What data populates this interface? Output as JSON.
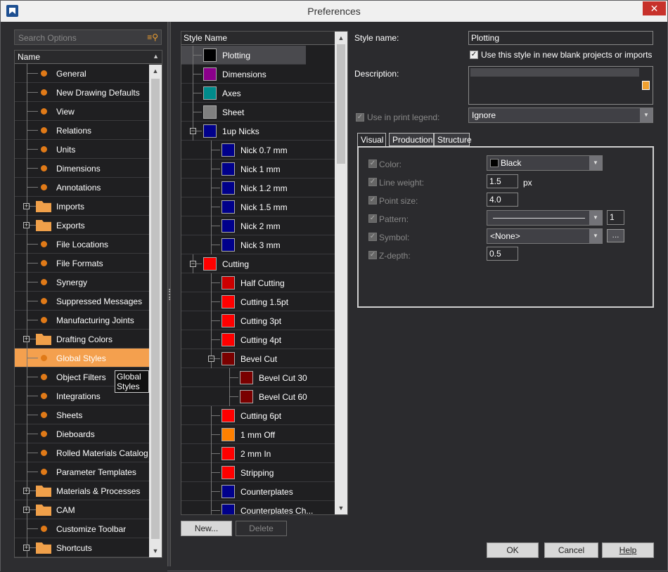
{
  "window": {
    "title": "Preferences",
    "close": "✕"
  },
  "left": {
    "search_placeholder": "Search Options",
    "tree_header": "Name",
    "items": [
      {
        "label": "General",
        "kind": "dot"
      },
      {
        "label": "New Drawing Defaults",
        "kind": "dot"
      },
      {
        "label": "View",
        "kind": "dot"
      },
      {
        "label": "Relations",
        "kind": "dot"
      },
      {
        "label": "Units",
        "kind": "dot"
      },
      {
        "label": "Dimensions",
        "kind": "dot"
      },
      {
        "label": "Annotations",
        "kind": "dot"
      },
      {
        "label": "Imports",
        "kind": "folder"
      },
      {
        "label": "Exports",
        "kind": "folder"
      },
      {
        "label": "File Locations",
        "kind": "dot"
      },
      {
        "label": "File Formats",
        "kind": "dot"
      },
      {
        "label": "Synergy",
        "kind": "dot"
      },
      {
        "label": "Suppressed Messages",
        "kind": "dot"
      },
      {
        "label": "Manufacturing Joints",
        "kind": "dot"
      },
      {
        "label": "Drafting Colors",
        "kind": "folder"
      },
      {
        "label": "Global Styles",
        "kind": "dot",
        "selected": true
      },
      {
        "label": "Object Filters",
        "kind": "dot"
      },
      {
        "label": "Integrations",
        "kind": "dot"
      },
      {
        "label": "Sheets",
        "kind": "dot"
      },
      {
        "label": "Dieboards",
        "kind": "dot"
      },
      {
        "label": "Rolled Materials Catalog",
        "kind": "dot"
      },
      {
        "label": "Parameter Templates",
        "kind": "dot"
      },
      {
        "label": "Materials & Processes",
        "kind": "folder"
      },
      {
        "label": "CAM",
        "kind": "folder"
      },
      {
        "label": "Customize Toolbar",
        "kind": "dot"
      },
      {
        "label": "Shortcuts",
        "kind": "folder"
      }
    ],
    "tooltip": "Global Styles"
  },
  "styles": {
    "header": "Style Name",
    "items": [
      {
        "label": "Plotting",
        "color": "#000000",
        "level": 0,
        "selected": true
      },
      {
        "label": "Dimensions",
        "color": "#8b008b",
        "level": 0
      },
      {
        "label": "Axes",
        "color": "#008b8b",
        "level": 0
      },
      {
        "label": "Sheet",
        "color": "#808080",
        "level": 0
      },
      {
        "label": "1up Nicks",
        "color": "#00008b",
        "level": 0,
        "expander": true
      },
      {
        "label": "Nick 0.7 mm",
        "color": "#00008b",
        "level": 1
      },
      {
        "label": "Nick 1 mm",
        "color": "#00008b",
        "level": 1
      },
      {
        "label": "Nick 1.2 mm",
        "color": "#00008b",
        "level": 1
      },
      {
        "label": "Nick 1.5 mm",
        "color": "#00008b",
        "level": 1
      },
      {
        "label": "Nick 2 mm",
        "color": "#00008b",
        "level": 1
      },
      {
        "label": "Nick 3 mm",
        "color": "#00008b",
        "level": 1
      },
      {
        "label": "Cutting",
        "color": "#ff0000",
        "level": 0,
        "expander": true
      },
      {
        "label": "Half Cutting",
        "color": "#cc0000",
        "level": 1
      },
      {
        "label": "Cutting 1.5pt",
        "color": "#ff0000",
        "level": 1
      },
      {
        "label": "Cutting 3pt",
        "color": "#ff0000",
        "level": 1
      },
      {
        "label": "Cutting 4pt",
        "color": "#ff0000",
        "level": 1
      },
      {
        "label": "Bevel Cut",
        "color": "#7a0000",
        "level": 1,
        "expander": true
      },
      {
        "label": "Bevel Cut 30",
        "color": "#7a0000",
        "level": 2
      },
      {
        "label": "Bevel Cut 60",
        "color": "#7a0000",
        "level": 2
      },
      {
        "label": "Cutting 6pt",
        "color": "#ff0000",
        "level": 1
      },
      {
        "label": "1 mm Off",
        "color": "#ff8000",
        "level": 1
      },
      {
        "label": "2 mm In",
        "color": "#ff0000",
        "level": 1
      },
      {
        "label": "Stripping",
        "color": "#ff0000",
        "level": 1
      },
      {
        "label": "Counterplates",
        "color": "#00008b",
        "level": 1
      },
      {
        "label": "Counterplates Ch...",
        "color": "#00008b",
        "level": 1
      }
    ],
    "new_label": "New...",
    "delete_label": "Delete"
  },
  "details": {
    "style_name_label": "Style name:",
    "style_name_value": "Plotting",
    "use_style_label": "Use this style in new blank projects or imports",
    "description_label": "Description:",
    "print_legend_label": "Use in print legend:",
    "print_legend_value": "Ignore",
    "tabs": [
      "Visual",
      "Production",
      "Structure"
    ],
    "visual": {
      "color_label": "Color:",
      "color_value": "Black",
      "line_weight_label": "Line weight:",
      "line_weight_value": "1.5",
      "line_weight_unit": "px",
      "point_size_label": "Point size:",
      "point_size_value": "4.0",
      "pattern_label": "Pattern:",
      "pattern_scale": "1",
      "symbol_label": "Symbol:",
      "symbol_value": "<None>",
      "symbol_button": "...",
      "zdepth_label": "Z-depth:",
      "zdepth_value": "0.5"
    }
  },
  "footer": {
    "ok": "OK",
    "cancel": "Cancel",
    "help": "Help"
  }
}
